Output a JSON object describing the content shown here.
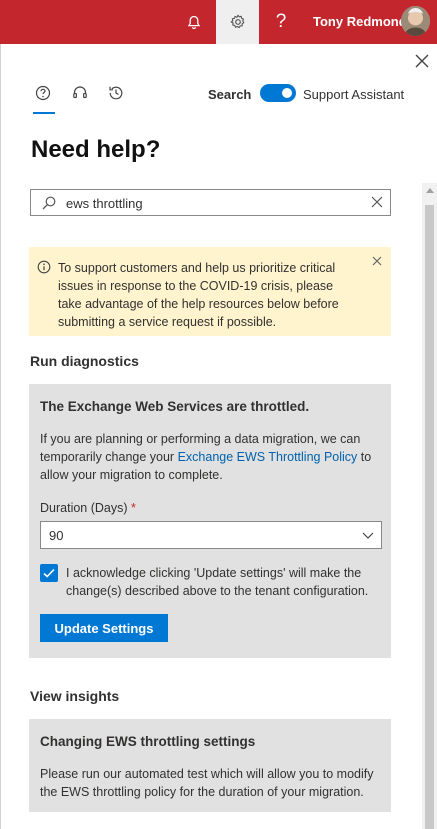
{
  "header": {
    "user_name": "Tony Redmond",
    "help_glyph": "?",
    "icons": [
      "bell-icon",
      "gear-icon",
      "help-icon"
    ],
    "accent_color": "#c4262e"
  },
  "panel": {
    "nav_icons": [
      "help-circle-icon",
      "headset-icon",
      "history-icon"
    ],
    "search_toggle_label": "Search",
    "support_assistant_label": "Support Assistant",
    "toggle_on": true,
    "title": "Need help?",
    "search": {
      "value": "ews throttling",
      "placeholder": ""
    },
    "notice": {
      "text": "To support customers and help us prioritize critical issues in response to the COVID-19 crisis, please take advantage of the help resources below before submitting a service request if possible.",
      "background": "#fff4ce"
    },
    "diagnostics": {
      "heading": "Run diagnostics",
      "card_title": "The Exchange Web Services are throttled.",
      "body_before": "If you are planning or performing a data migration, we can temporarily change your ",
      "link": "Exchange EWS Throttling Policy",
      "body_after": " to allow your migration to complete.",
      "duration_label": "Duration (Days)",
      "required_mark": "*",
      "duration_value": "90",
      "acknowledge_checked": true,
      "acknowledge_text": "I acknowledge clicking 'Update settings' will make the change(s) described above to the tenant configuration.",
      "update_button": "Update Settings"
    },
    "insights": {
      "heading": "View insights",
      "card_title": "Changing EWS throttling settings",
      "body": "Please run our automated test which will allow you to modify the EWS throttling policy for the duration of your migration."
    }
  }
}
